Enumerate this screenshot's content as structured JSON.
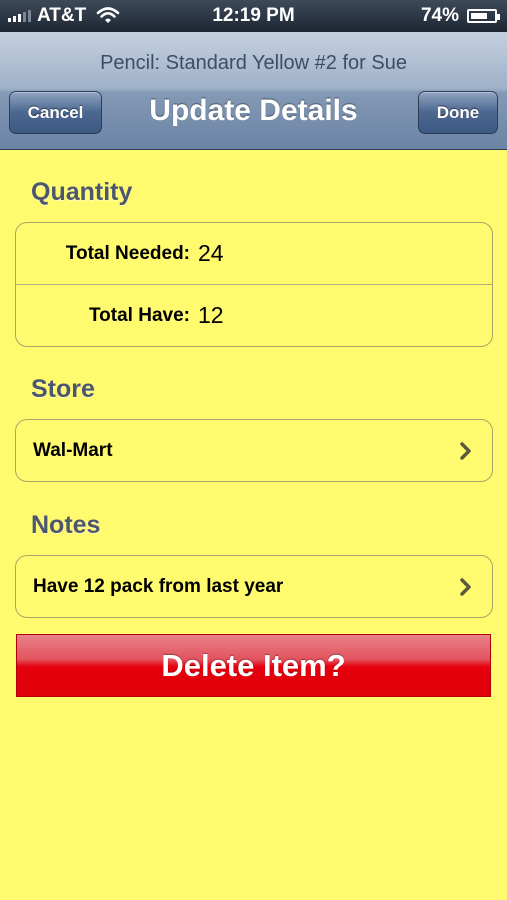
{
  "status_bar": {
    "carrier": "AT&T",
    "time": "12:19 PM",
    "battery_percent": "74%",
    "battery_level": 0.74,
    "signal_bars": 3,
    "wifi_icon": "wifi-icon"
  },
  "nav": {
    "prompt": "Pencil: Standard Yellow #2 for Sue",
    "title": "Update Details",
    "cancel_label": "Cancel",
    "done_label": "Done"
  },
  "quantity": {
    "header": "Quantity",
    "total_needed_label": "Total Needed:",
    "total_needed_value": "24",
    "total_have_label": "Total Have:",
    "total_have_value": "12"
  },
  "store": {
    "header": "Store",
    "value": "Wal-Mart"
  },
  "notes": {
    "header": "Notes",
    "value": "Have 12 pack from last year"
  },
  "delete_label": "Delete Item?",
  "colors": {
    "background": "#FFFA6E",
    "delete_red": "#E4000C",
    "nav_blue": "#6B84A4"
  }
}
